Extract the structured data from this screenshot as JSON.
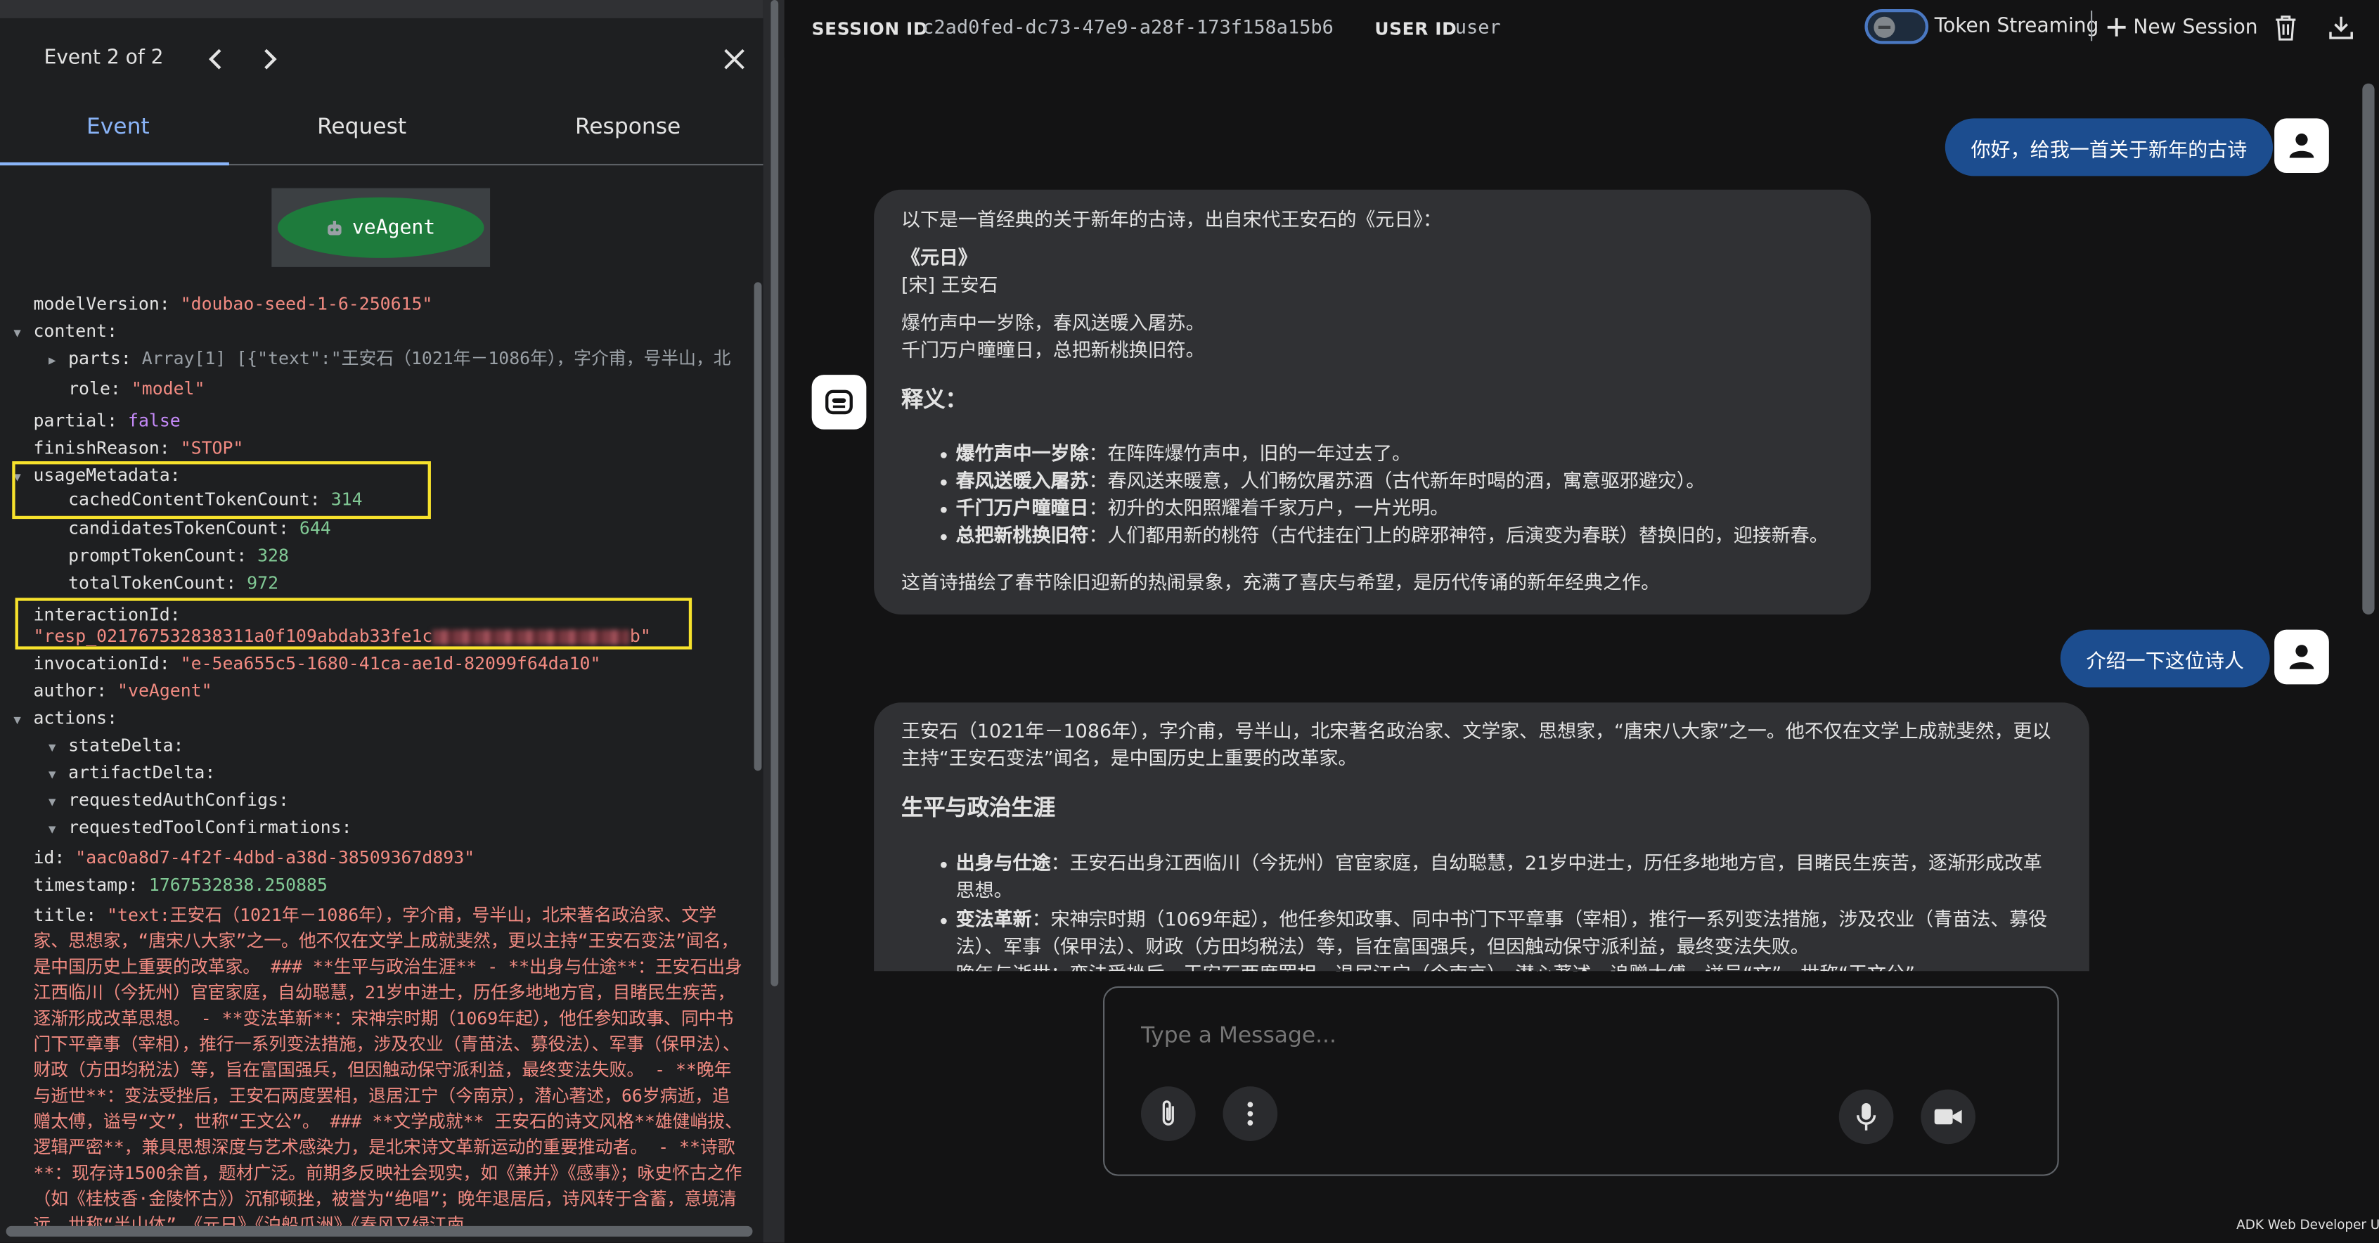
{
  "event_panel": {
    "counter": "Event 2 of 2",
    "tabs": [
      "Event",
      "Request",
      "Response"
    ],
    "graph_node_label": "veAgent",
    "json": {
      "modelVersion_key": "modelVersion:",
      "modelVersion_val": "\"doubao-seed-1-6-250615\"",
      "content_key": "content:",
      "parts_key": "parts:",
      "parts_val": "Array[1] [{\"text\":\"王安石（1021年－1086年），字介甫，号半山，北",
      "role_key": "role:",
      "role_val": "\"model\"",
      "partial_key": "partial:",
      "partial_val": "false",
      "finishReason_key": "finishReason:",
      "finishReason_val": "\"STOP\"",
      "usageMetadata_key": "usageMetadata:",
      "cached_key": "cachedContentTokenCount:",
      "cached_val": "314",
      "candidates_key": "candidatesTokenCount:",
      "candidates_val": "644",
      "prompt_key": "promptTokenCount:",
      "prompt_val": "328",
      "total_key": "totalTokenCount:",
      "total_val": "972",
      "interaction_key": "interactionId:",
      "interaction_val_start": "\"resp_021767532838311a0f109abdab33fe1c",
      "interaction_val_end": "b\"",
      "invocation_key": "invocationId:",
      "invocation_val": "\"e-5ea655c5-1680-41ca-ae1d-82099f64da10\"",
      "author_key": "author:",
      "author_val": "\"veAgent\"",
      "actions_key": "actions:",
      "stateDelta_key": "stateDelta:",
      "artifactDelta_key": "artifactDelta:",
      "requestedAuthConfigs_key": "requestedAuthConfigs:",
      "requestedToolConfirmations_key": "requestedToolConfirmations:",
      "id_key": "id:",
      "id_val": "\"aac0a8d7-4f2f-4dbd-a38d-38509367d893\"",
      "timestamp_key": "timestamp:",
      "timestamp_val": "1767532838.250885",
      "title_key": "title:",
      "title_val": "\"text:王安石（1021年－1086年），字介甫，号半山，北宋著名政治家、文学家、思想家，“唐宋八大家”之一。他不仅在文学上成就斐然，更以主持“王安石变法”闻名，是中国历史上重要的改革家。 ### **生平与政治生涯** - **出身与仕途**：王安石出身江西临川（今抚州）官宦家庭，自幼聪慧，21岁中进士，历任多地地方官，目睹民生疾苦，逐渐形成改革思想。 - **变法革新**：宋神宗时期（1069年起），他任参知政事、同中书门下平章事（宰相），推行一系列变法措施，涉及农业（青苗法、募役法）、军事（保甲法）、财政（方田均税法）等，旨在富国强兵，但因触动保守派利益，最终变法失败。 - **晚年与逝世**：变法受挫后，王安石两度罢相，退居江宁（今南京），潜心著述，66岁病逝，追赠太傅，谥号“文”，世称“王文公”。 ### **文学成就** 王安石的诗文风格**雄健峭拔、逻辑严密**，兼具思想深度与艺术感染力，是北宋诗文革新运动的重要推动者。 - **诗歌**：现存诗1500余首，题材广泛。前期多反映社会现实，如《兼并》《感事》；咏史怀古之作（如《桂枝香·金陵怀古》）沉郁顿挫，被誉为“绝唱”；晚年退居后，诗风转于含蓄，意境清远，世称“半山体”。《元日》《泊船瓜洲》《春风又绿江南"
    }
  },
  "session": {
    "session_label": "SESSION ID",
    "session_id": "c2ad0fed-dc73-47e9-a28f-173f158a15b6",
    "user_label": "USER ID",
    "user_id": "user",
    "token_streaming_label": "Token Streaming",
    "new_session_label": "New Session"
  },
  "chat": {
    "user_message_1": "你好，给我一首关于新年的古诗",
    "bot_message_1": {
      "intro": "以下是一首经典的关于新年的古诗，出自宋代王安石的《元日》：",
      "poem_title": "《元日》",
      "poem_author": "[宋] 王安石",
      "poem_line_1": "爆竹声中一岁除，春风送暖入屠苏。",
      "poem_line_2": "千门万户曈曈日，总把新桃换旧符。",
      "heading": "释义：",
      "items": [
        {
          "term": "爆竹声中一岁除",
          "desc": "：在阵阵爆竹声中，旧的一年过去了。"
        },
        {
          "term": "春风送暖入屠苏",
          "desc": "：春风送来暖意，人们畅饮屠苏酒（古代新年时喝的酒，寓意驱邪避灾）。"
        },
        {
          "term": "千门万户曈曈日",
          "desc": "：初升的太阳照耀着千家万户，一片光明。"
        },
        {
          "term": "总把新桃换旧符",
          "desc": "：人们都用新的桃符（古代挂在门上的辟邪神符，后演变为春联）替换旧的，迎接新春。"
        }
      ],
      "outro": "这首诗描绘了春节除旧迎新的热闹景象，充满了喜庆与希望，是历代传诵的新年经典之作。"
    },
    "user_message_2": "介绍一下这位诗人",
    "bot_message_2": {
      "para_line_1": "王安石（1021年－1086年），字介甫，号半山，北宋著名政治家、文学家、思想家，“唐宋八大家”之一。他不仅在文学上成就斐然，更以",
      "para_line_2": "主持“王安石变法”闻名，是中国历史上重要的改革家。",
      "heading": "生平与政治生涯",
      "item1_term": "出身与仕途",
      "item1_line_1": "：王安石出身江西临川（今抚州）官宦家庭，自幼聪慧，21岁中进士，历任多地地方官，目睹民生疾苦，逐渐形成改革",
      "item1_line_2": "思想。",
      "item2_term": "变法革新",
      "item2_line_1": "：宋神宗时期（1069年起），他任参知政事、同中书门下平章事（宰相），推行一系列变法措施，涉及农业（青苗法、募役",
      "item2_line_2": "法）、军事（保甲法）、财政（方田均税法）等，旨在富国强兵，但因触动保守派利益，最终变法失败。",
      "item3_partial": "晚年与逝世：变法受挫后，王安石两度罢相，退居江宁（今南京），潜心著述，追赠太傅，谥号“文”，世称“王文公”。"
    }
  },
  "input": {
    "placeholder": "Type a Message..."
  },
  "footer": "ADK Web Developer UI",
  "colors": {
    "highlight": "#f7e22c",
    "user_bubble": "#1c4d8f",
    "accent": "#8ab4f8"
  },
  "icons": [
    "chevron-left-icon",
    "chevron-right-icon",
    "close-icon",
    "robot-icon",
    "plus-icon",
    "trash-icon",
    "download-icon",
    "person-icon",
    "paperclip-icon",
    "more-vert-icon",
    "mic-icon",
    "video-icon"
  ]
}
